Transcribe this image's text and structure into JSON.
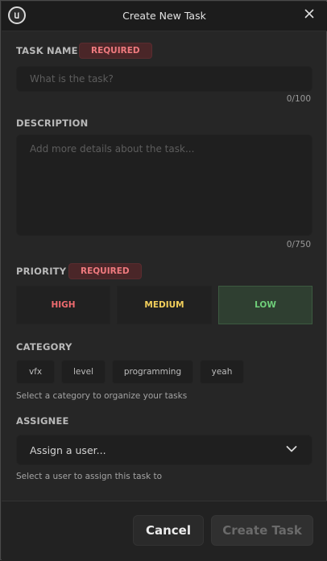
{
  "window": {
    "title": "Create New Task"
  },
  "task_name": {
    "label": "TASK NAME",
    "badge": "REQUIRED",
    "placeholder": "What is the task?",
    "counter": "0/100"
  },
  "description": {
    "label": "DESCRIPTION",
    "placeholder": "Add more details about the task...",
    "counter": "0/750"
  },
  "priority": {
    "label": "PRIORITY",
    "badge": "REQUIRED",
    "options": [
      {
        "label": "HIGH",
        "color": "#ef6b6f"
      },
      {
        "label": "MEDIUM",
        "color": "#f2cf5b"
      },
      {
        "label": "LOW",
        "color": "#6fcf7a"
      }
    ],
    "selected": "LOW"
  },
  "category": {
    "label": "CATEGORY",
    "chips": [
      "vfx",
      "level",
      "programming",
      "yeah"
    ],
    "hint": "Select a category to organize your tasks"
  },
  "assignee": {
    "label": "ASSIGNEE",
    "value": "Assign a user...",
    "hint": "Select a user to assign this task to"
  },
  "footer": {
    "cancel_label": "Cancel",
    "create_label": "Create Task"
  },
  "icons": {
    "logo": "unreal-logo-icon",
    "close": "close-icon",
    "dropdown": "chevron-down-icon"
  }
}
